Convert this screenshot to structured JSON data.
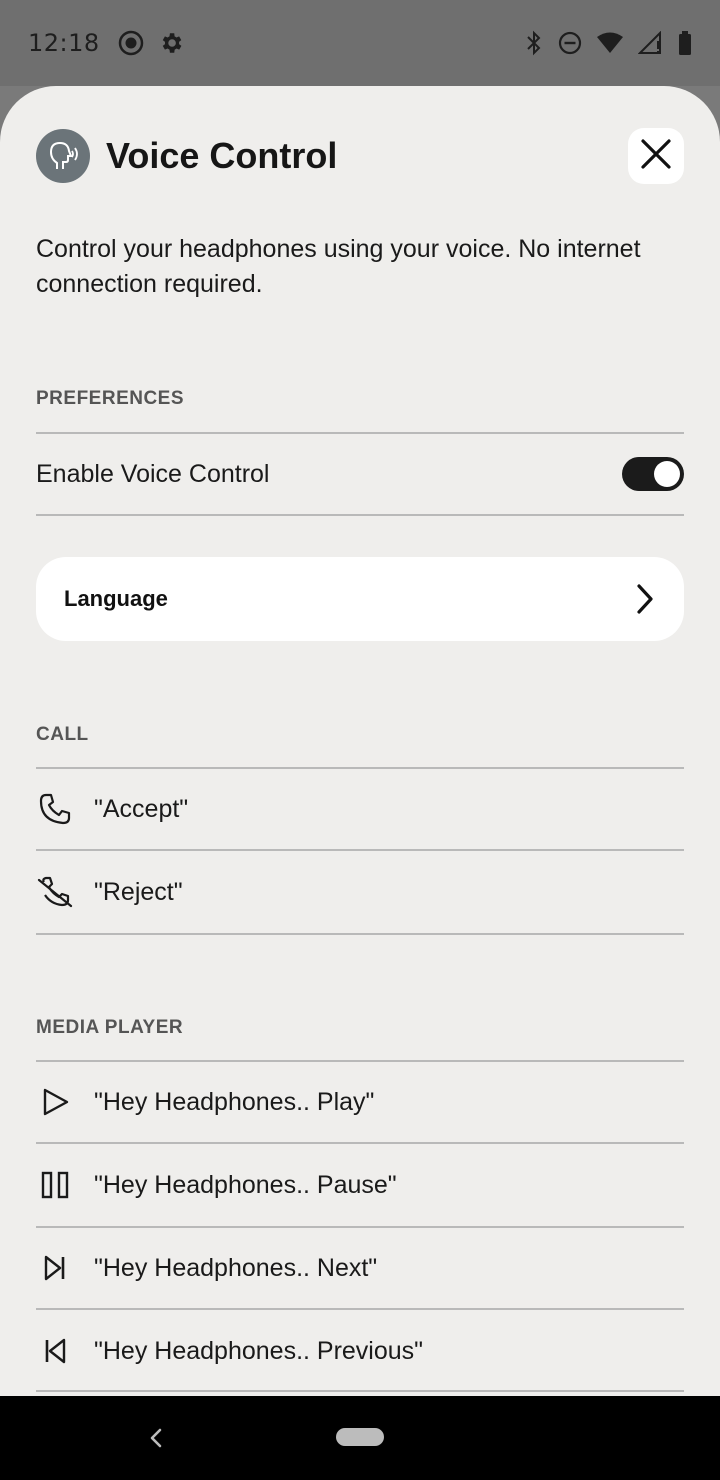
{
  "status_bar": {
    "time": "12:18",
    "left_icons": [
      "record-icon",
      "gear-icon"
    ],
    "right_icons": [
      "bluetooth-icon",
      "do-not-disturb-icon",
      "wifi-icon",
      "signal-icon",
      "battery-icon"
    ]
  },
  "header": {
    "icon": "voice-head-icon",
    "title": "Voice Control",
    "close_icon": "close-icon"
  },
  "description": "Control your headphones using your voice. No internet connection required.",
  "preferences": {
    "label": "PREFERENCES",
    "enable_label": "Enable Voice Control",
    "enable_value": true,
    "language_label": "Language"
  },
  "call": {
    "label": "CALL",
    "items": [
      {
        "icon": "phone-icon",
        "text": "\"Accept\""
      },
      {
        "icon": "phone-off-icon",
        "text": "\"Reject\""
      }
    ]
  },
  "media": {
    "label": "MEDIA PLAYER",
    "items": [
      {
        "icon": "play-icon",
        "text": "\"Hey Headphones.. Play\""
      },
      {
        "icon": "pause-icon",
        "text": "\"Hey Headphones.. Pause\""
      },
      {
        "icon": "next-icon",
        "text": "\"Hey Headphones.. Next\""
      },
      {
        "icon": "previous-icon",
        "text": "\"Hey Headphones.. Previous\""
      }
    ]
  },
  "colors": {
    "sheet_bg": "#efeeec",
    "toggle_on": "#1b1b1b",
    "header_icon_bg": "#6b7479"
  }
}
